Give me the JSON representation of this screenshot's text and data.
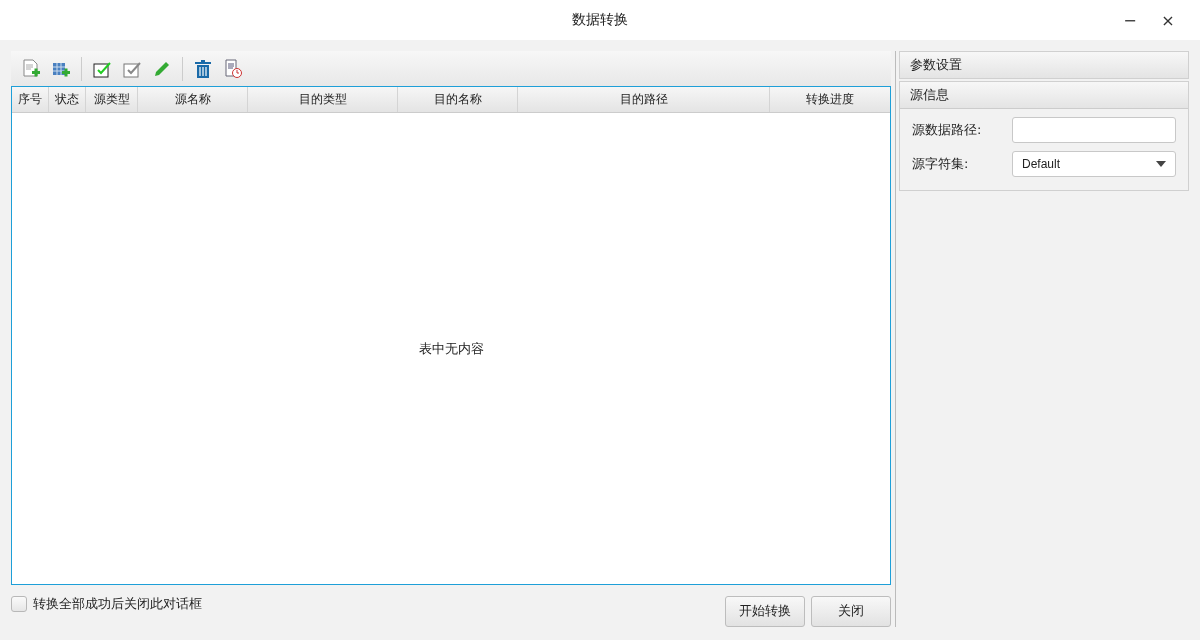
{
  "window": {
    "title": "数据转换",
    "controls": [
      "−",
      "×"
    ]
  },
  "table": {
    "columns": [
      "序号",
      "状态",
      "源类型",
      "源名称",
      "目的类型",
      "目的名称",
      "目的路径",
      "转换进度"
    ],
    "empty_message": "表中无内容"
  },
  "close_on_success": {
    "label": "转换全部成功后关闭此对话框",
    "checked": false
  },
  "buttons": [
    "开始转换",
    "关闭"
  ],
  "sidebar": {
    "sections": [
      {
        "title": "参数设置"
      },
      {
        "title": "源信息",
        "fields": [
          {
            "kind": "text",
            "label": "源数据路径:"
          },
          {
            "kind": "select",
            "label": "源字符集:",
            "value": "Default"
          }
        ]
      }
    ]
  }
}
